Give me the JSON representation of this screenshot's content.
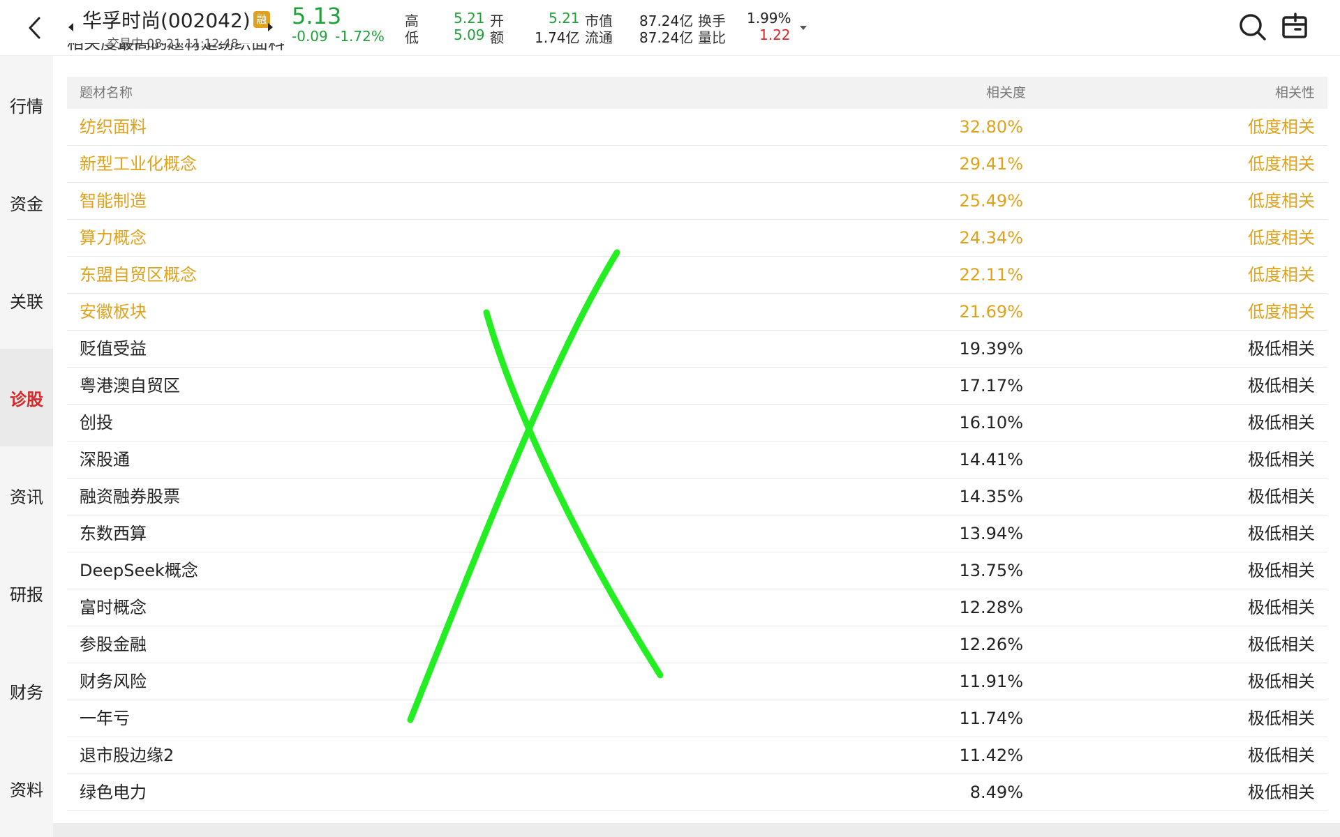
{
  "header": {
    "stock_name": "华孚时尚(002042)",
    "rong_badge": "融",
    "trade_status": "交易中 08-21 11:12:48",
    "price": "5.13",
    "change": "-0.09  -1.72%",
    "stats": {
      "high_label": "高",
      "low_label": "低",
      "high_value": "5.21",
      "low_value": "5.09",
      "open_label": "开",
      "amount_label": "额",
      "open_value": "5.21",
      "amount_value": "1.74亿",
      "mktcap_label": "市值",
      "float_label": "流通",
      "mktcap_value": "87.24亿",
      "float_value": "87.24亿",
      "turnover_label": "换手",
      "volratio_label": "量比",
      "turnover_value": "1.99%",
      "volratio_value": "1.22"
    }
  },
  "sidebar": {
    "items": [
      {
        "label": "行情"
      },
      {
        "label": "资金"
      },
      {
        "label": "关联"
      },
      {
        "label": "诊股",
        "active": true
      },
      {
        "label": "资讯"
      },
      {
        "label": "研报"
      },
      {
        "label": "财务"
      },
      {
        "label": "资料"
      }
    ]
  },
  "main": {
    "cut_off_text": "相关度最高的题材是纺织面料",
    "table": {
      "headers": {
        "name": "题材名称",
        "degree": "相关度",
        "relation": "相关性"
      },
      "rows": [
        {
          "name": "纺织面料",
          "degree": "32.80%",
          "relation": "低度相关",
          "highlight": true
        },
        {
          "name": "新型工业化概念",
          "degree": "29.41%",
          "relation": "低度相关",
          "highlight": true
        },
        {
          "name": "智能制造",
          "degree": "25.49%",
          "relation": "低度相关",
          "highlight": true
        },
        {
          "name": "算力概念",
          "degree": "24.34%",
          "relation": "低度相关",
          "highlight": true
        },
        {
          "name": "东盟自贸区概念",
          "degree": "22.11%",
          "relation": "低度相关",
          "highlight": true
        },
        {
          "name": "安徽板块",
          "degree": "21.69%",
          "relation": "低度相关",
          "highlight": true
        },
        {
          "name": "贬值受益",
          "degree": "19.39%",
          "relation": "极低相关",
          "highlight": false
        },
        {
          "name": "粤港澳自贸区",
          "degree": "17.17%",
          "relation": "极低相关",
          "highlight": false
        },
        {
          "name": "创投",
          "degree": "16.10%",
          "relation": "极低相关",
          "highlight": false
        },
        {
          "name": "深股通",
          "degree": "14.41%",
          "relation": "极低相关",
          "highlight": false
        },
        {
          "name": "融资融券股票",
          "degree": "14.35%",
          "relation": "极低相关",
          "highlight": false
        },
        {
          "name": "东数西算",
          "degree": "13.94%",
          "relation": "极低相关",
          "highlight": false
        },
        {
          "name": "DeepSeek概念",
          "degree": "13.75%",
          "relation": "极低相关",
          "highlight": false
        },
        {
          "name": "富时概念",
          "degree": "12.28%",
          "relation": "极低相关",
          "highlight": false
        },
        {
          "name": "参股金融",
          "degree": "12.26%",
          "relation": "极低相关",
          "highlight": false
        },
        {
          "name": "财务风险",
          "degree": "11.91%",
          "relation": "极低相关",
          "highlight": false
        },
        {
          "name": "一年亏",
          "degree": "11.74%",
          "relation": "极低相关",
          "highlight": false
        },
        {
          "name": "退市股边缘2",
          "degree": "11.42%",
          "relation": "极低相关",
          "highlight": false
        },
        {
          "name": "绿色电力",
          "degree": "8.49%",
          "relation": "极低相关",
          "highlight": false
        }
      ]
    }
  },
  "colors": {
    "highlight": "#e0a21b",
    "up": "#d92626",
    "down": "#1fa13a",
    "annotation": "#22ee22"
  },
  "icons": [
    "back-arrow-icon",
    "prev-stock-icon",
    "next-stock-icon",
    "dropdown-caret-icon",
    "search-icon",
    "window-icon"
  ]
}
